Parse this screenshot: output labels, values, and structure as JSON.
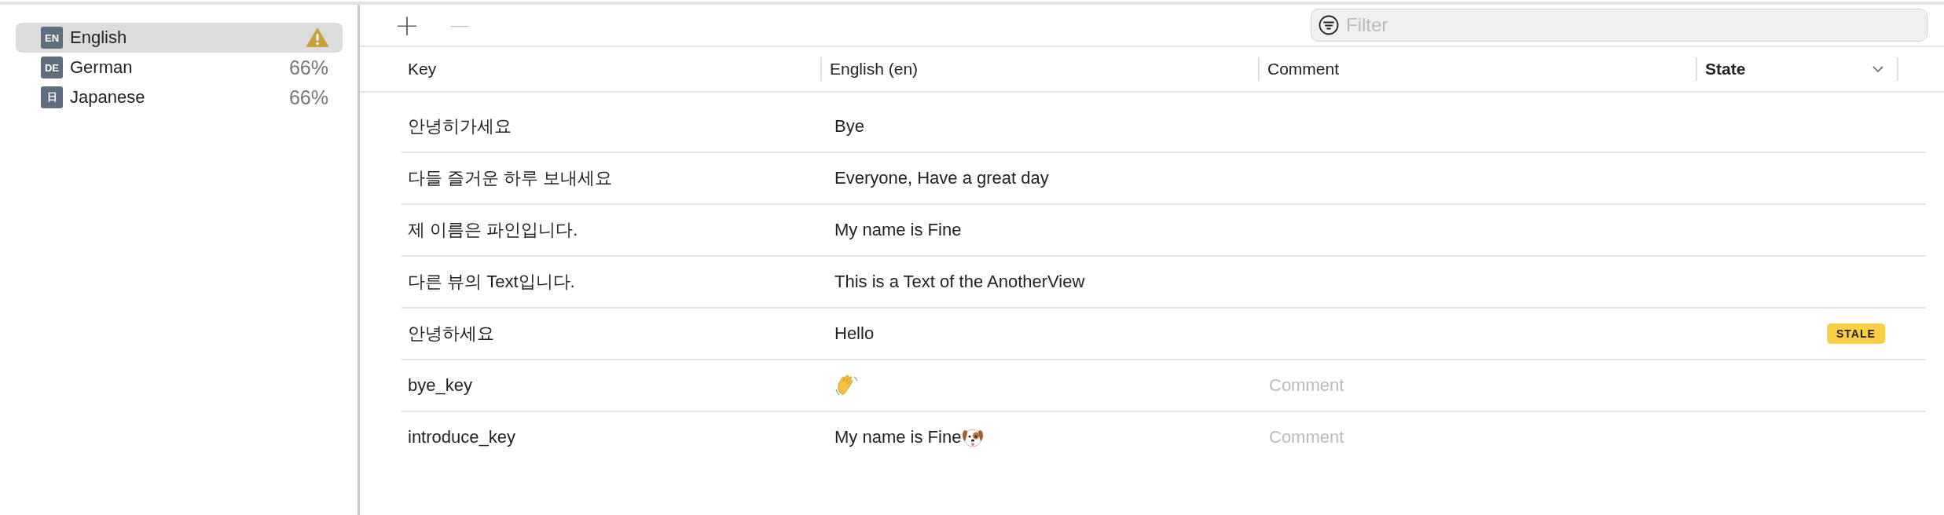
{
  "sidebar": {
    "items": [
      {
        "code": "EN",
        "name": "English",
        "selected": true,
        "warning": true
      },
      {
        "code": "DE",
        "name": "German",
        "selected": false,
        "warning": false,
        "progress": "66%"
      },
      {
        "code": "日",
        "name": "Japanese",
        "selected": false,
        "warning": false,
        "progress": "66%"
      }
    ]
  },
  "toolbar": {
    "add": "+",
    "remove": "—",
    "filter": {
      "placeholder": "Filter"
    }
  },
  "table": {
    "columns": [
      {
        "label": "Key",
        "bold": false,
        "sort": false
      },
      {
        "label": "English (en)",
        "bold": false,
        "sort": false
      },
      {
        "label": "Comment",
        "bold": false,
        "sort": false
      },
      {
        "label": "State",
        "bold": true,
        "sort": true
      }
    ],
    "rows": [
      {
        "key": "안녕히가세요",
        "english": "Bye"
      },
      {
        "key": "다들 즐거운 하루 보내세요",
        "english": "Everyone, Have a great day"
      },
      {
        "key": "제 이름은 파인입니다.",
        "english": "My name is Fine"
      },
      {
        "key": "다른 뷰의 Text입니다.",
        "english": "This is a Text of the AnotherView"
      },
      {
        "key": "안녕하세요",
        "english": "Hello",
        "state": "STALE"
      },
      {
        "key": "bye_key",
        "kind": "wave",
        "comment_placeholder": "Comment"
      },
      {
        "key": "introduce_key",
        "english": "My name is Fine",
        "kind": "dog",
        "comment_placeholder": "Comment"
      }
    ]
  }
}
